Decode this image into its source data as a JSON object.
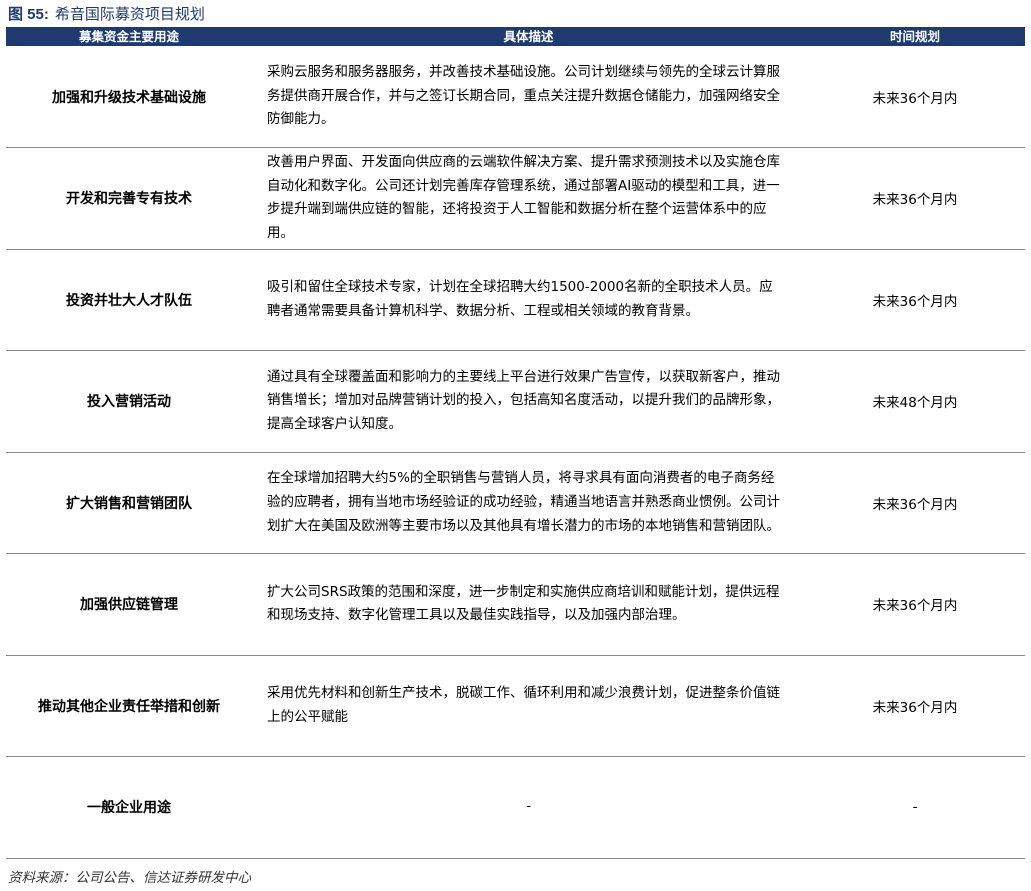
{
  "figure": {
    "label": "图 55:",
    "name": "希音国际募资项目规划"
  },
  "table": {
    "headers": [
      "募集资金主要用途",
      "具体描述",
      "时间规划"
    ],
    "rows": [
      {
        "use": "加强和升级技术基础设施",
        "desc": "采购云服务和服务器服务，并改善技术基础设施。公司计划继续与领先的全球云计算服务提供商开展合作，并与之签订长期合同，重点关注提升数据仓储能力，加强网络安全防御能力。",
        "time": "未来36个月内"
      },
      {
        "use": "开发和完善专有技术",
        "desc": "改善用户界面、开发面向供应商的云端软件解决方案、提升需求预测技术以及实施仓库自动化和数字化。公司还计划完善库存管理系统，通过部署AI驱动的模型和工具，进一步提升端到端供应链的智能，还将投资于人工智能和数据分析在整个运营体系中的应用。",
        "time": "未来36个月内"
      },
      {
        "use": "投资并壮大人才队伍",
        "desc": "吸引和留住全球技术专家，计划在全球招聘大约1500-2000名新的全职技术人员。应聘者通常需要具备计算机科学、数据分析、工程或相关领域的教育背景。",
        "time": "未来36个月内"
      },
      {
        "use": "投入营销活动",
        "desc": "通过具有全球覆盖面和影响力的主要线上平台进行效果广告宣传，以获取新客户，推动销售增长；增加对品牌营销计划的投入，包括高知名度活动，以提升我们的品牌形象，提高全球客户认知度。",
        "time": "未来48个月内"
      },
      {
        "use": "扩大销售和营销团队",
        "desc": "在全球增加招聘大约5%的全职销售与营销人员，将寻求具有面向消费者的电子商务经验的应聘者，拥有当地市场经验证的成功经验，精通当地语言并熟悉商业惯例。公司计划扩大在美国及欧洲等主要市场以及其他具有增长潜力的市场的本地销售和营销团队。",
        "time": "未来36个月内"
      },
      {
        "use": "加强供应链管理",
        "desc": "扩大公司SRS政策的范围和深度，进一步制定和实施供应商培训和赋能计划，提供远程和现场支持、数字化管理工具以及最佳实践指导，以及加强内部治理。",
        "time": "未来36个月内"
      },
      {
        "use": "推动其他企业责任举措和创新",
        "desc": "采用优先材料和创新生产技术，脱碳工作、循环利用和减少浪费计划，促进整条价值链上的公平赋能",
        "time": "未来36个月内"
      },
      {
        "use": "一般企业用途",
        "desc": "-",
        "time": "-"
      }
    ]
  },
  "source": "资料来源：公司公告、信达证券研发中心",
  "colors": {
    "header_bg": "#1f3a6e",
    "title_text": "#1f3a6e"
  }
}
